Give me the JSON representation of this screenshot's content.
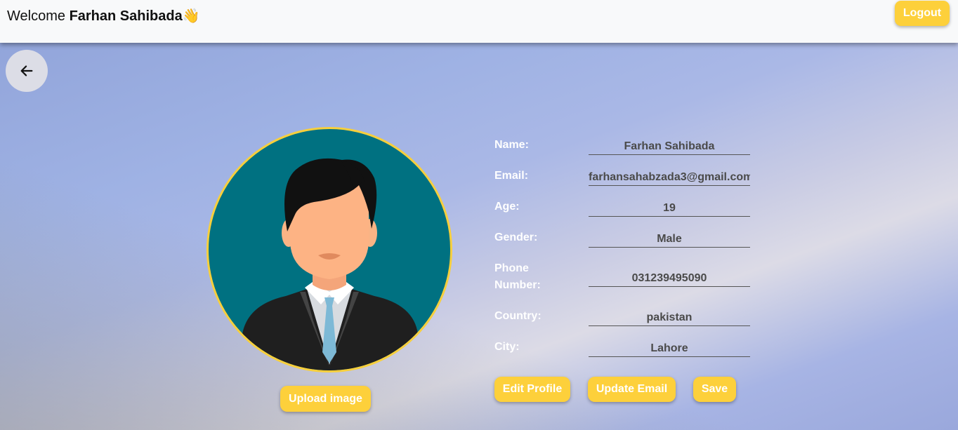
{
  "navbar": {
    "welcome_prefix": "Welcome",
    "user_name": "Farhan Sahibada",
    "wave_emoji": "👋",
    "logout_label": "Logout"
  },
  "back_icon": "arrow-left-icon",
  "profile": {
    "upload_label": "Upload image",
    "fields": [
      {
        "label": "Name:",
        "value": "Farhan Sahibada"
      },
      {
        "label": "Email:",
        "value": "farhansahabzada3@gmail.com"
      },
      {
        "label": "Age:",
        "value": "19"
      },
      {
        "label": "Gender:",
        "value": "Male"
      },
      {
        "label": "Phone Number:",
        "value": "031239495090"
      },
      {
        "label": "Country:",
        "value": "pakistan"
      },
      {
        "label": "City:",
        "value": "Lahore"
      }
    ]
  },
  "actions": {
    "edit_label": "Edit Profile",
    "update_email_label": "Update Email",
    "save_label": "Save"
  },
  "colors": {
    "accent": "#fdd03b",
    "avatar_bg": "#007181",
    "avatar_border": "#f7cf3c"
  }
}
